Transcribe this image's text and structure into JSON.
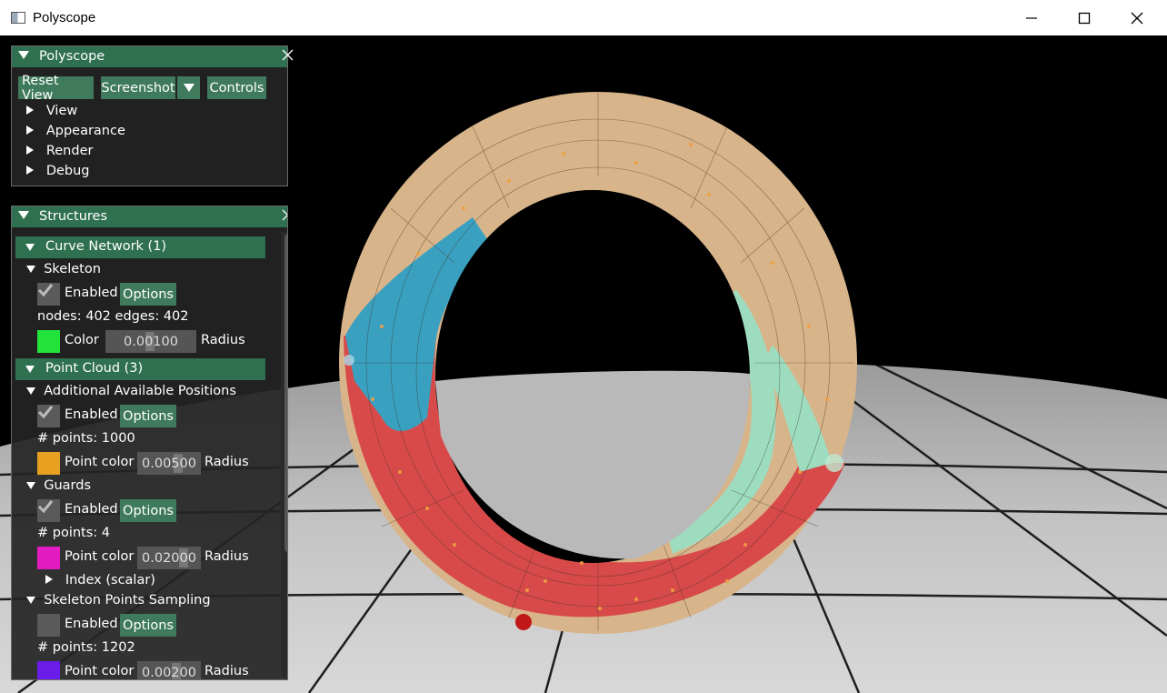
{
  "window": {
    "title": "Polyscope"
  },
  "polyscope_panel": {
    "title": "Polyscope",
    "buttons": {
      "reset_view": "Reset View",
      "screenshot": "Screenshot",
      "controls": "Controls"
    },
    "menu": [
      "View",
      "Appearance",
      "Render",
      "Debug"
    ]
  },
  "structures_panel": {
    "title": "Structures",
    "curve_network": {
      "header": "Curve Network (1)",
      "skeleton": {
        "name": "Skeleton",
        "enabled_label": "Enabled",
        "options_label": "Options",
        "stats": "nodes: 402  edges: 402",
        "color_label": "Color",
        "color": "#22e33a",
        "radius_value": "0.00100",
        "radius_label": "Radius"
      }
    },
    "point_cloud": {
      "header": "Point Cloud (3)",
      "additional": {
        "name": "Additional Available Positions",
        "enabled_label": "Enabled",
        "options_label": "Options",
        "stats": "# points: 1000",
        "color_label": "Point color",
        "color": "#e8a020",
        "radius_value": "0.00500",
        "radius_label": "Radius"
      },
      "guards": {
        "name": "Guards",
        "enabled_label": "Enabled",
        "options_label": "Options",
        "stats": "# points: 4",
        "color_label": "Point color",
        "color": "#e21cc0",
        "radius_value": "0.02000",
        "radius_label": "Radius",
        "quantity": "Index (scalar)"
      },
      "sampling": {
        "name": "Skeleton Points Sampling",
        "enabled_label": "Enabled",
        "options_label": "Options",
        "stats": "# points: 1202",
        "color_label": "Point color",
        "color": "#6a1ce8",
        "radius_value": "0.00200",
        "radius_label": "Radius"
      }
    }
  },
  "colors": {
    "accent": "#2f7050",
    "button": "#3f7a5c",
    "torus_red": "#d84a4a",
    "torus_tan": "#d8b48a",
    "torus_blue": "#3aa0c0",
    "torus_mint": "#9edcc0"
  }
}
